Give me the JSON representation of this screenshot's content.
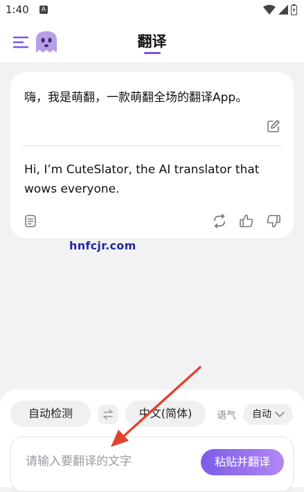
{
  "status_bar": {
    "time": "1:40",
    "notification_icon": "A",
    "icons": [
      "wifi-icon",
      "signal-icon",
      "battery-icon"
    ]
  },
  "app_bar": {
    "title": "翻译",
    "icons": [
      "menu-icon",
      "ghost-mascot-icon"
    ]
  },
  "translation_card": {
    "source_text": "嗨，我是萌翻，一款萌翻全场的翻译App。",
    "result_text": "Hi, I’m CuteSlator, the AI translator that wows everyone.",
    "icons": [
      "edit-icon",
      "copy-icon",
      "refresh-icon",
      "thumbs-up-icon",
      "thumbs-down-icon"
    ]
  },
  "watermark": "hnfcjr.com",
  "language_bar": {
    "source_language": "自动检测",
    "target_language": "中文(简体)",
    "tone_label": "语气",
    "tone_value": "自动"
  },
  "input": {
    "placeholder": "请输入要翻译的文字",
    "paste_button": "粘贴并翻译"
  },
  "colors": {
    "accent": "#7b52e6",
    "button_gradient_start": "#7c5ce8",
    "button_gradient_end": "#b288f5",
    "background": "#f2f2f4",
    "annotation_arrow": "#e0432f"
  }
}
